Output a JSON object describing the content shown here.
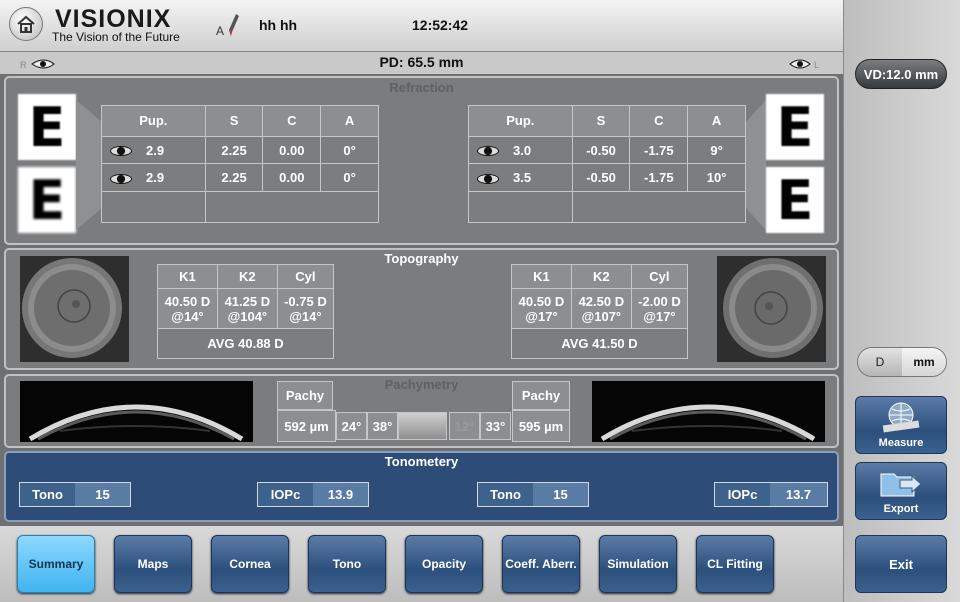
{
  "header": {
    "logo": "VISIONIX",
    "tagline": "The Vision of the Future",
    "user_initial": "A",
    "username": "hh hh",
    "time": "12:52:42",
    "home_icon": "home-icon"
  },
  "pd": {
    "label": "PD: 65.5 mm"
  },
  "vd": {
    "label": "VD:12.0 mm"
  },
  "refraction": {
    "title": "Refraction",
    "headers": [
      "Pup.",
      "S",
      "C",
      "A"
    ],
    "right_eye": [
      {
        "pup": "2.9",
        "s": "2.25",
        "c": "0.00",
        "a": "0°"
      },
      {
        "pup": "2.9",
        "s": "2.25",
        "c": "0.00",
        "a": "0°"
      }
    ],
    "left_eye": [
      {
        "pup": "3.0",
        "s": "-0.50",
        "c": "-1.75",
        "a": "9°"
      },
      {
        "pup": "3.5",
        "s": "-0.50",
        "c": "-1.75",
        "a": "10°"
      }
    ],
    "chart_letter": "E"
  },
  "topography": {
    "title": "Topography",
    "headers": [
      "K1",
      "K2",
      "Cyl"
    ],
    "right": {
      "k1": "40.50 D",
      "k1a": "@14°",
      "k2": "41.25 D",
      "k2a": "@104°",
      "cyl": "-0.75 D",
      "cyla": "@14°",
      "avg": "AVG 40.88 D"
    },
    "left": {
      "k1": "40.50 D",
      "k1a": "@17°",
      "k2": "42.50 D",
      "k2a": "@107°",
      "cyl": "-2.00 D",
      "cyla": "@17°",
      "avg": "AVG 41.50 D"
    }
  },
  "pachymetry": {
    "title": "Pachymetry",
    "label": "Pachy",
    "right_value": "592 µm",
    "left_value": "595 µm",
    "angles": [
      "24°",
      "38°",
      "12°",
      "33°"
    ]
  },
  "tonometry": {
    "title": "Tonometery",
    "right": {
      "tono_label": "Tono",
      "tono": "15",
      "iopc_label": "IOPc",
      "iopc": "13.9"
    },
    "left": {
      "tono_label": "Tono",
      "tono": "15",
      "iopc_label": "IOPc",
      "iopc": "13.7"
    }
  },
  "units": {
    "d": "D",
    "mm": "mm"
  },
  "side_buttons": {
    "measure": "Measure",
    "export": "Export",
    "exit": "Exit"
  },
  "tabs": [
    "Summary",
    "Maps",
    "Cornea",
    "Tono",
    "Opacity",
    "Coeff. Aberr.",
    "Simulation",
    "CL Fitting"
  ],
  "colors": {
    "accent_active": "#3fb4f0",
    "tab_blue": "#2c4f7c",
    "tono_panel": "#3f628c"
  }
}
